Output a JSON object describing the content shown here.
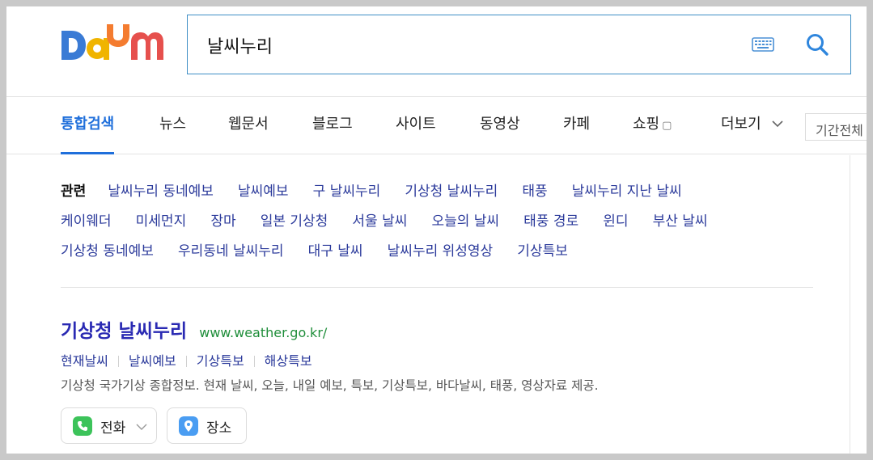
{
  "header": {
    "logo_text": "Daum",
    "search": {
      "value": "날씨누리",
      "placeholder": ""
    },
    "keyboard_icon": "keyboard-icon",
    "search_icon": "search-icon"
  },
  "tabs": [
    {
      "label": "통합검색",
      "active": true
    },
    {
      "label": "뉴스"
    },
    {
      "label": "웹문서"
    },
    {
      "label": "블로그"
    },
    {
      "label": "사이트"
    },
    {
      "label": "동영상"
    },
    {
      "label": "카페"
    },
    {
      "label": "쇼핑"
    },
    {
      "label": "더보기"
    }
  ],
  "period_filter": "기간전체",
  "related": {
    "label": "관련",
    "rows": [
      [
        "날씨누리 동네예보",
        "날씨예보",
        "구 날씨누리",
        "기상청 날씨누리",
        "태풍",
        "날씨누리 지난 날씨"
      ],
      [
        "케이웨더",
        "미세먼지",
        "장마",
        "일본 기상청",
        "서울 날씨",
        "오늘의 날씨",
        "태풍 경로",
        "윈디",
        "부산 날씨"
      ],
      [
        "기상청 동네예보",
        "우리동네 날씨누리",
        "대구 날씨",
        "날씨누리 위성영상",
        "기상특보"
      ]
    ]
  },
  "result": {
    "title": "기상청 날씨누리",
    "url": "www.weather.go.kr/",
    "sublinks": [
      "현재날씨",
      "날씨예보",
      "기상특보",
      "해상특보"
    ],
    "description": "기상청 국가기상 종합정보. 현재 날씨, 오늘, 내일 예보, 특보, 기상특보, 바다날씨, 태풍, 영상자료 제공.",
    "chips": [
      {
        "label": "전화",
        "icon": "phone-icon",
        "color": "#3cc35a"
      },
      {
        "label": "장소",
        "icon": "location-pin-icon",
        "color": "#4a9df2"
      }
    ]
  },
  "colors": {
    "accent": "#1f6fdb",
    "search_border": "#3f8fc5",
    "link": "#2b3a9b",
    "title": "#2a2ab3",
    "url": "#1f8e3a"
  }
}
